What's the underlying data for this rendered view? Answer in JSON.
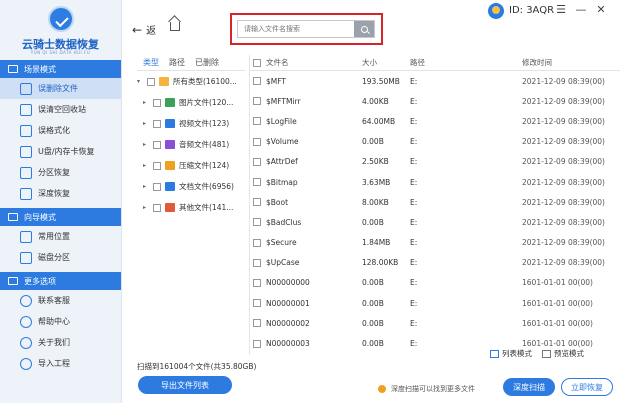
{
  "app": {
    "logo_title": "云骑士数据恢复",
    "logo_sub": "YUN QI SHI DATA HUI FU",
    "user_id": "ID: 3AQR"
  },
  "sidebar": {
    "sections": [
      {
        "label": "场景模式",
        "items": [
          "误删除文件",
          "误清空回收站",
          "误格式化",
          "U盘/内存卡恢复",
          "分区恢复",
          "深度恢复"
        ]
      },
      {
        "label": "向导模式",
        "items": [
          "常用位置",
          "磁盘分区"
        ]
      },
      {
        "label": "更多选项",
        "items": [
          "联系客服",
          "帮助中心",
          "关于我们",
          "导入工程"
        ]
      }
    ],
    "active_item": "误删除文件"
  },
  "topbar": {
    "back_label": "返",
    "search_placeholder": "请输入文件名搜索"
  },
  "tree": {
    "tabs": [
      "类型",
      "路径",
      "已删除"
    ],
    "items": [
      {
        "label": "所有类型(16100...",
        "color": "#f3b33d",
        "root": true
      },
      {
        "label": "图片文件(120...",
        "color": "#3aa05a"
      },
      {
        "label": "视频文件(123)",
        "color": "#2d7be0"
      },
      {
        "label": "音频文件(481)",
        "color": "#8a4fd6"
      },
      {
        "label": "压缩文件(124)",
        "color": "#f0a020"
      },
      {
        "label": "文档文件(6956)",
        "color": "#2d7be0"
      },
      {
        "label": "其他文件(141...",
        "color": "#e05a3a"
      }
    ]
  },
  "table": {
    "headers": {
      "name": "文件名",
      "size": "大小",
      "path": "路径",
      "time": "修改时间"
    },
    "rows": [
      {
        "name": "$MFT",
        "size": "193.50MB",
        "path": "E:",
        "time": "2021-12-09 08:39(00)"
      },
      {
        "name": "$MFTMirr",
        "size": "4.00KB",
        "path": "E:",
        "time": "2021-12-09 08:39(00)"
      },
      {
        "name": "$LogFile",
        "size": "64.00MB",
        "path": "E:",
        "time": "2021-12-09 08:39(00)"
      },
      {
        "name": "$Volume",
        "size": "0.00B",
        "path": "E:",
        "time": "2021-12-09 08:39(00)"
      },
      {
        "name": "$AttrDef",
        "size": "2.50KB",
        "path": "E:",
        "time": "2021-12-09 08:39(00)"
      },
      {
        "name": "$Bitmap",
        "size": "3.63MB",
        "path": "E:",
        "time": "2021-12-09 08:39(00)"
      },
      {
        "name": "$Boot",
        "size": "8.00KB",
        "path": "E:",
        "time": "2021-12-09 08:39(00)"
      },
      {
        "name": "$BadClus",
        "size": "0.00B",
        "path": "E:",
        "time": "2021-12-09 08:39(00)"
      },
      {
        "name": "$Secure",
        "size": "1.84MB",
        "path": "E:",
        "time": "2021-12-09 08:39(00)"
      },
      {
        "name": "$UpCase",
        "size": "128.00KB",
        "path": "E:",
        "time": "2021-12-09 08:39(00)"
      },
      {
        "name": "N00000000",
        "size": "0.00B",
        "path": "E:",
        "time": "1601-01-01 00(00)"
      },
      {
        "name": "N00000001",
        "size": "0.00B",
        "path": "E:",
        "time": "1601-01-01 00(00)"
      },
      {
        "name": "N00000002",
        "size": "0.00B",
        "path": "E:",
        "time": "1601-01-01 00(00)"
      },
      {
        "name": "N00000003",
        "size": "0.00B",
        "path": "E:",
        "time": "1601-01-01 00(00)"
      }
    ]
  },
  "view": {
    "list_label": "列表模式",
    "preview_label": "预览模式"
  },
  "footer": {
    "scan_status": "扫描到161004个文件(共35.80GB)",
    "export_label": "导出文件列表",
    "hint": "深度扫描可以找到更多文件",
    "deep_scan_label": "深度扫描",
    "recover_label": "立即恢复"
  }
}
